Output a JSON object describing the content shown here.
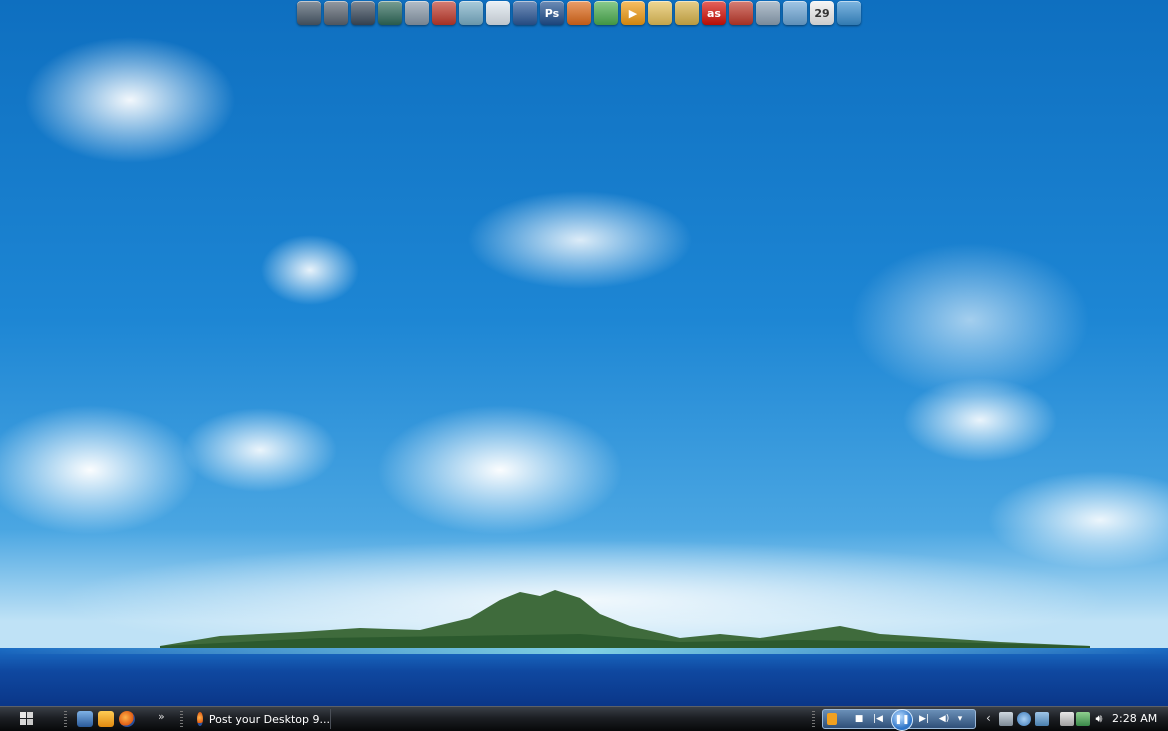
{
  "dock": {
    "icons": [
      {
        "name": "monitor-icon",
        "glyph": "",
        "color": "#4a5a6a"
      },
      {
        "name": "media-library-icon",
        "glyph": "",
        "color": "#5a6470"
      },
      {
        "name": "user-icon",
        "glyph": "",
        "color": "#3c4b5c"
      },
      {
        "name": "phone-icon",
        "glyph": "",
        "color": "#2f6a5a"
      },
      {
        "name": "documents-icon",
        "glyph": "",
        "color": "#8a9aaa"
      },
      {
        "name": "book-icon",
        "glyph": "",
        "color": "#c0392b"
      },
      {
        "name": "network-icon",
        "glyph": "",
        "color": "#7bb0c8"
      },
      {
        "name": "notepad-icon",
        "glyph": "",
        "color": "#dfe8f0"
      },
      {
        "name": "word-icon",
        "glyph": "",
        "color": "#2b5797"
      },
      {
        "name": "photoshop-icon",
        "glyph": "Ps",
        "color": "#1f4f8f"
      },
      {
        "name": "firefox-icon",
        "glyph": "",
        "color": "#e06a1a"
      },
      {
        "name": "messenger-icon",
        "glyph": "",
        "color": "#4caf50"
      },
      {
        "name": "media-player-icon",
        "glyph": "▶",
        "color": "#f39c12"
      },
      {
        "name": "folder-icon",
        "glyph": "",
        "color": "#e6c25a"
      },
      {
        "name": "folder-icon",
        "glyph": "",
        "color": "#d9b44a"
      },
      {
        "name": "lastfm-icon",
        "glyph": "as",
        "color": "#d51007"
      },
      {
        "name": "block-icon",
        "glyph": "",
        "color": "#c0392b"
      },
      {
        "name": "search-icon",
        "glyph": "",
        "color": "#8fa3b6"
      },
      {
        "name": "computer-icon",
        "glyph": "",
        "color": "#6fa8d8"
      },
      {
        "name": "calendar-icon",
        "glyph": "29",
        "color": "#f0f0f0"
      },
      {
        "name": "settings-icon",
        "glyph": "",
        "color": "#3a8fd0"
      }
    ]
  },
  "taskbar": {
    "task_label": "Post your Desktop 9...",
    "quick_launch_more": "»",
    "clock": "2:28 AM",
    "tray_expand": "‹",
    "media": {
      "stop": "■",
      "prev": "|◀",
      "play_pause": "❚❚",
      "next": "▶|",
      "volume": "◀)",
      "dropdown": "▾"
    }
  },
  "colors": {
    "taskbar_top": "#3a3f47",
    "taskbar_bottom": "#070809",
    "sky": "#1d86d4"
  }
}
